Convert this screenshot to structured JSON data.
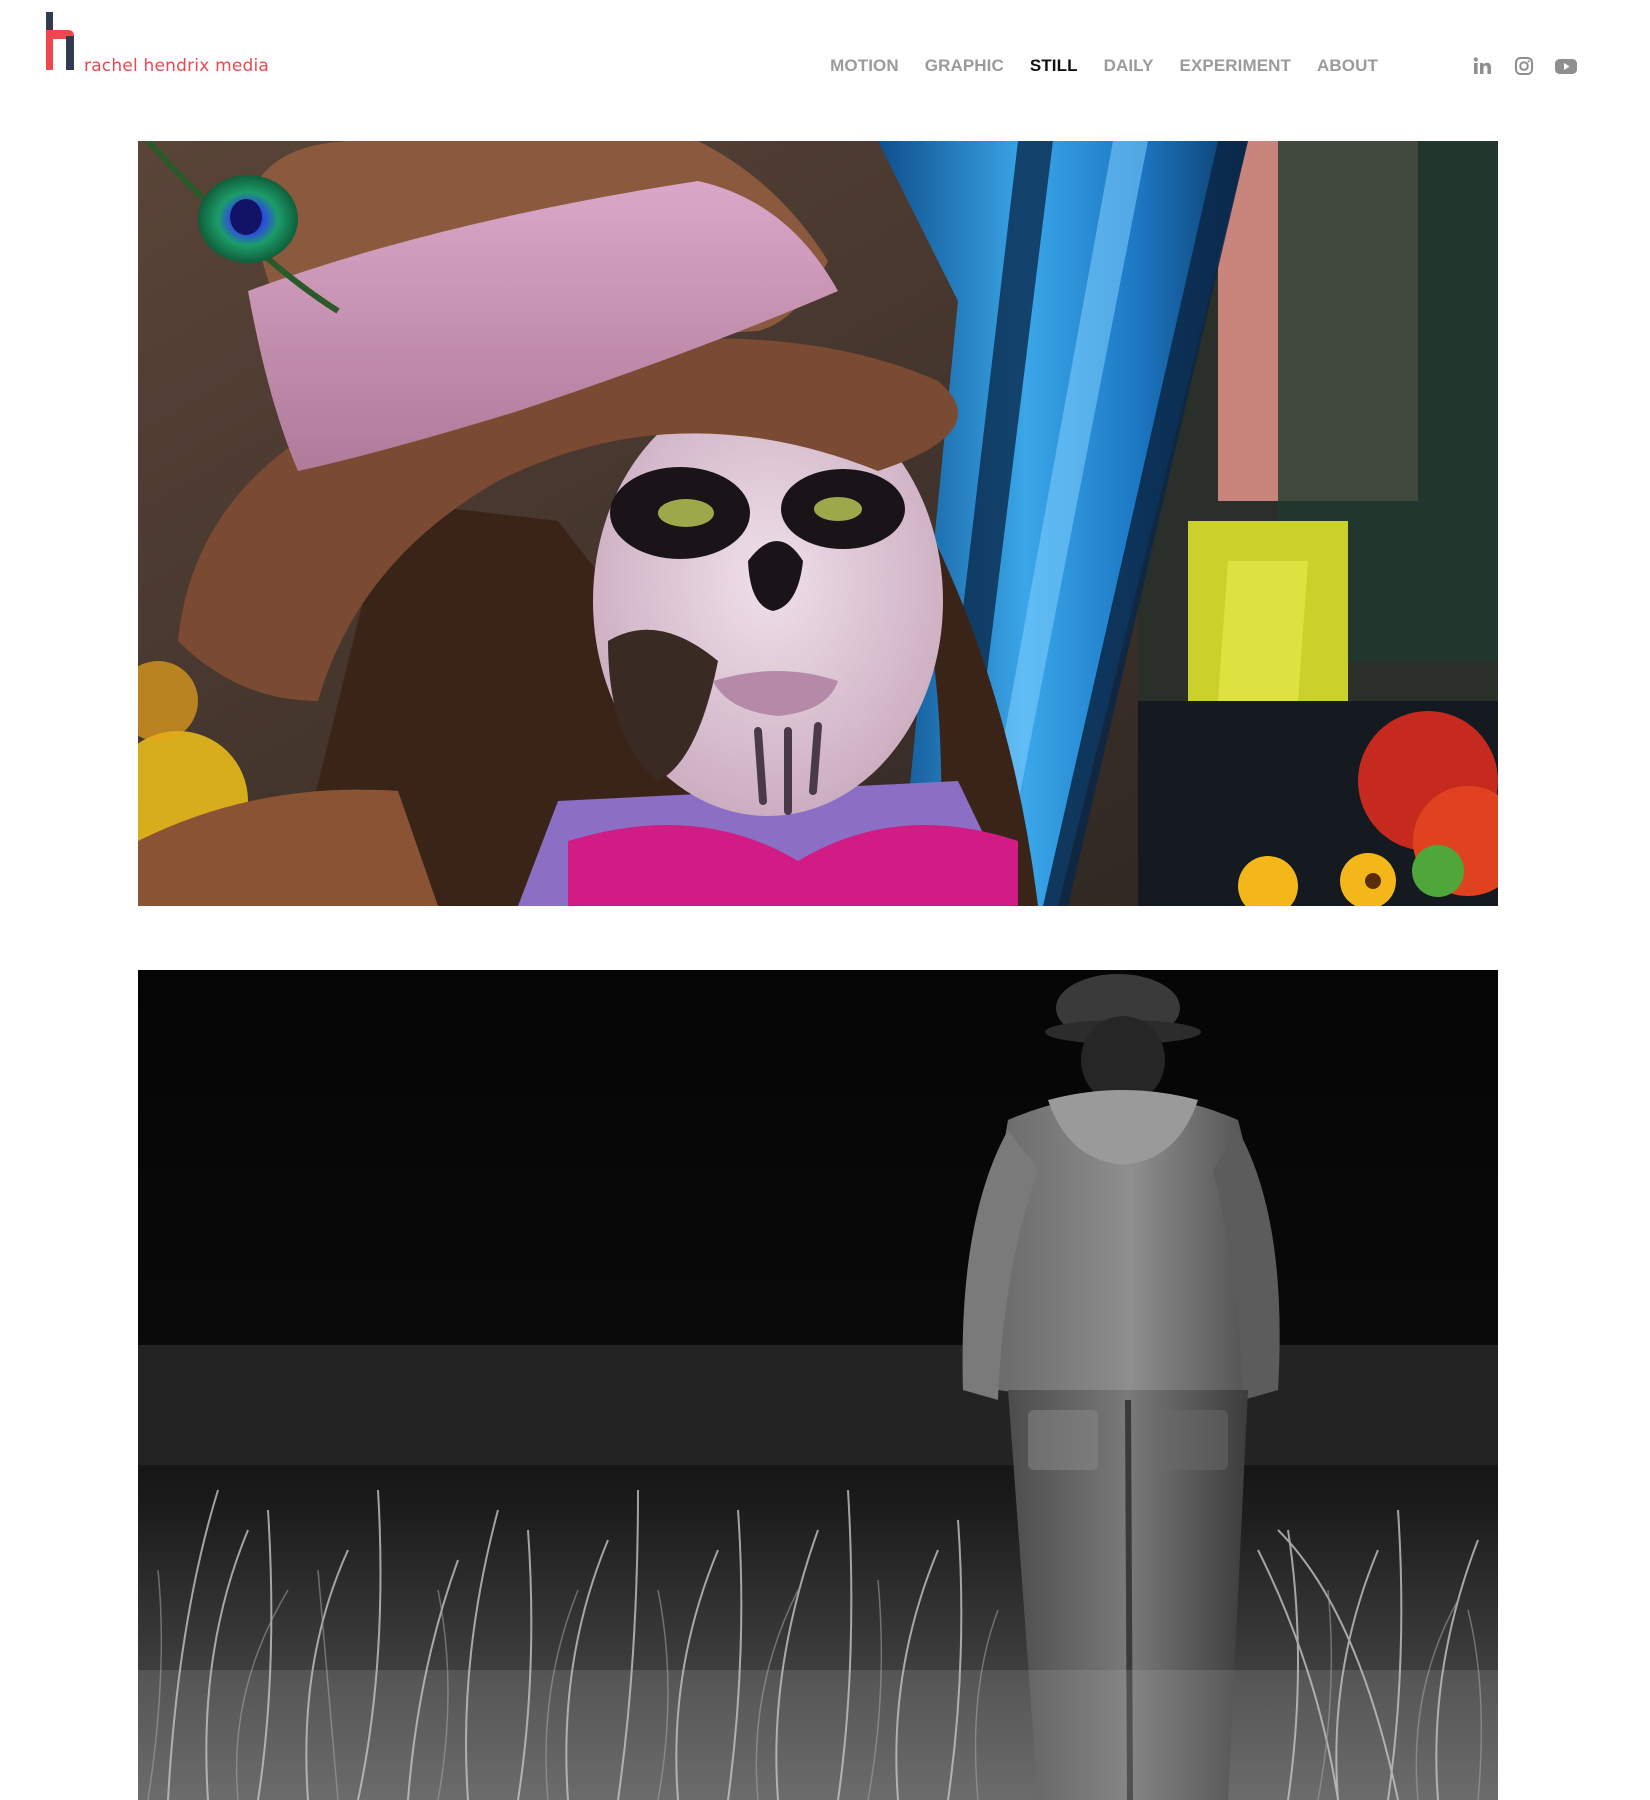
{
  "header": {
    "logo_text": "rachel hendrix media",
    "nav": [
      {
        "label": "MOTION",
        "active": false
      },
      {
        "label": "GRAPHIC",
        "active": false
      },
      {
        "label": "STILL",
        "active": true
      },
      {
        "label": "DAILY",
        "active": false
      },
      {
        "label": "EXPERIMENT",
        "active": false
      },
      {
        "label": "ABOUT",
        "active": false
      }
    ],
    "social_icons": [
      "linkedin-icon",
      "instagram-icon",
      "youtube-icon"
    ],
    "colors": {
      "brand_red": "#f0474f",
      "brand_navy": "#2f3c52",
      "nav_gray": "#9b9b9b",
      "nav_active": "#111111"
    }
  },
  "gallery": {
    "photos": [
      {
        "subject": "day-of-the-dead-portrait"
      },
      {
        "subject": "night-field-figure"
      }
    ]
  }
}
